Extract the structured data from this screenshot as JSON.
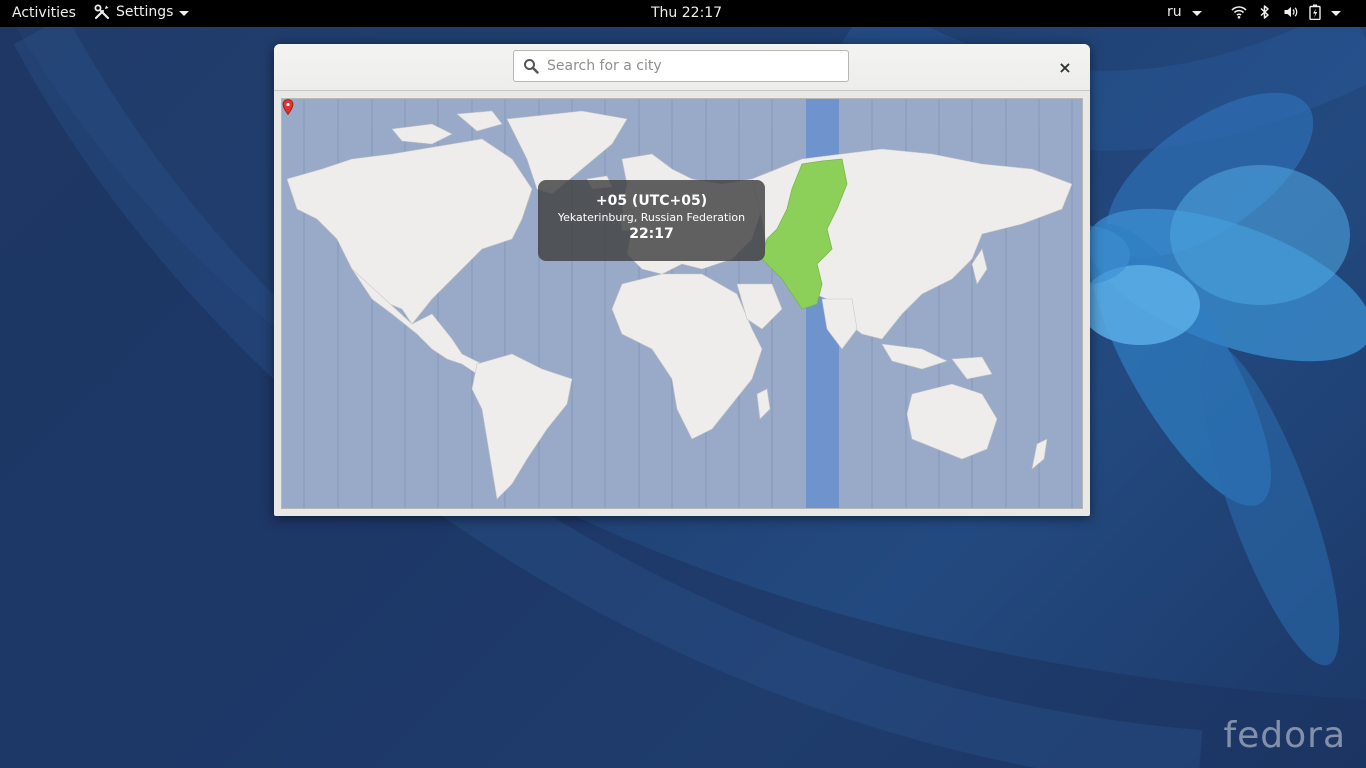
{
  "topbar": {
    "activities_label": "Activities",
    "app_menu_label": "Settings",
    "clock": "Thu 22:17",
    "input_language": "ru",
    "icons": [
      "wifi-icon",
      "bluetooth-icon",
      "volume-icon",
      "battery-icon",
      "system-menu-caret-icon"
    ]
  },
  "dialog": {
    "search": {
      "placeholder": "Search for a city",
      "value": ""
    },
    "close_label": "×",
    "timezone_popup": {
      "name": "+05 (UTC+05)",
      "city": "Yekaterinburg, Russian Federation",
      "time": "22:17"
    }
  },
  "desktop": {
    "logo_text": "fedora"
  },
  "colors": {
    "topbar": "#000000",
    "map_ocean": "#98aac8",
    "selected_zone": "#6f93cc",
    "selected_region": "#8cd05a",
    "land": "#efedec",
    "pin": "#e0322a"
  }
}
